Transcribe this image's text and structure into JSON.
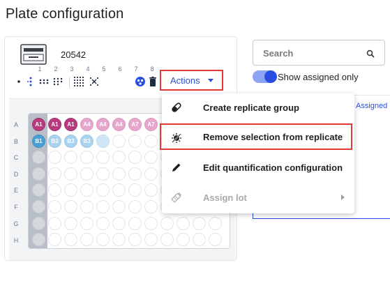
{
  "page": {
    "title": "Plate configuration"
  },
  "plate": {
    "id": "20542",
    "columns": [
      "1",
      "2",
      "3",
      "4",
      "5",
      "6",
      "7",
      "8"
    ],
    "rows": [
      "A",
      "B",
      "C",
      "D",
      "E",
      "F",
      "G",
      "H"
    ],
    "wells_row_a": [
      "A1",
      "A1",
      "A1",
      "A4",
      "A4",
      "A4",
      "A7",
      "A7"
    ],
    "wells_row_b": [
      "B1",
      "B3",
      "B3",
      "B3"
    ]
  },
  "toolbar": {
    "actions_label": "Actions",
    "icons": [
      "single-well-icon",
      "column-select-icon",
      "row-select-icon",
      "block-select-icon",
      "grid-select-icon",
      "clear-grid-icon",
      "replicate-icon",
      "delete-icon"
    ]
  },
  "actions_menu": {
    "items": [
      {
        "label": "Create replicate group",
        "icon": "pill-icon",
        "disabled": false
      },
      {
        "label": "Remove selection from replicate",
        "icon": "pill-remove-icon",
        "disabled": false
      },
      {
        "label": "Edit quantification configuration",
        "icon": "pencil-icon",
        "disabled": false
      },
      {
        "label": "Assign lot",
        "icon": "vial-icon",
        "disabled": true
      }
    ]
  },
  "sidebar": {
    "search_placeholder": "Search",
    "toggle_label": "Show assigned only",
    "toggle_on": true,
    "tab_label": "Assigned"
  },
  "colors": {
    "accent": "#2a4ee3",
    "highlight": "#e53935",
    "replicate_a": "#b73b7d",
    "replicate_b": "#4b9fd6"
  }
}
